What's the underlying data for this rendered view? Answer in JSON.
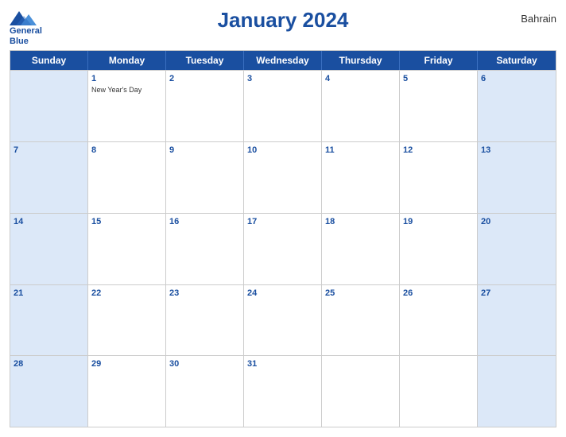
{
  "header": {
    "logo_line1": "General",
    "logo_line2": "Blue",
    "title": "January 2024",
    "country": "Bahrain"
  },
  "days_of_week": [
    "Sunday",
    "Monday",
    "Tuesday",
    "Wednesday",
    "Thursday",
    "Friday",
    "Saturday"
  ],
  "weeks": [
    [
      {
        "date": "",
        "empty": true
      },
      {
        "date": "1",
        "event": "New Year's Day"
      },
      {
        "date": "2"
      },
      {
        "date": "3"
      },
      {
        "date": "4"
      },
      {
        "date": "5"
      },
      {
        "date": "6"
      }
    ],
    [
      {
        "date": "7"
      },
      {
        "date": "8"
      },
      {
        "date": "9"
      },
      {
        "date": "10"
      },
      {
        "date": "11"
      },
      {
        "date": "12"
      },
      {
        "date": "13"
      }
    ],
    [
      {
        "date": "14"
      },
      {
        "date": "15"
      },
      {
        "date": "16"
      },
      {
        "date": "17"
      },
      {
        "date": "18"
      },
      {
        "date": "19"
      },
      {
        "date": "20"
      }
    ],
    [
      {
        "date": "21"
      },
      {
        "date": "22"
      },
      {
        "date": "23"
      },
      {
        "date": "24"
      },
      {
        "date": "25"
      },
      {
        "date": "26"
      },
      {
        "date": "27"
      }
    ],
    [
      {
        "date": "28"
      },
      {
        "date": "29"
      },
      {
        "date": "30"
      },
      {
        "date": "31"
      },
      {
        "date": ""
      },
      {
        "date": ""
      },
      {
        "date": ""
      }
    ]
  ]
}
